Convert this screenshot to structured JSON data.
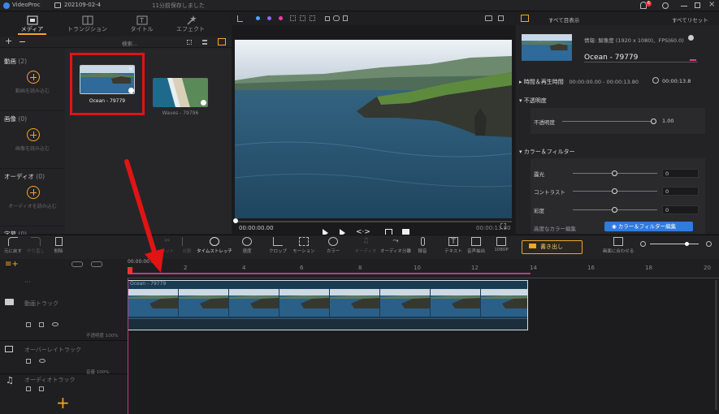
{
  "titlebar": {
    "app": "VideoProc",
    "project": "202109-02-4",
    "saved": "11分前保存しました",
    "notif_count": "6"
  },
  "tabs": [
    {
      "label": "メディア"
    },
    {
      "label": "トランジション"
    },
    {
      "label": "タイトル"
    },
    {
      "label": "エフェクト"
    }
  ],
  "media": {
    "search_placeholder": "検索...",
    "sections": [
      {
        "title": "動画",
        "count": "(2)",
        "hint": "動画を読み込む"
      },
      {
        "title": "画像",
        "count": "(0)",
        "hint": "画像を読み込む"
      },
      {
        "title": "オーディオ",
        "count": "(0)",
        "hint": "オーディオを読み込む"
      },
      {
        "title": "字幕",
        "count": "(0)"
      }
    ],
    "items": [
      {
        "name": "Ocean - 79779",
        "selected": true
      },
      {
        "name": "Waves - 79796",
        "selected": false
      }
    ]
  },
  "preview": {
    "time_current": "00:00:00.00",
    "time_total": "00:00:13.80"
  },
  "inspector": {
    "show_all": "すべて目表示",
    "reset_all": "すべてリセット",
    "info": "情報: 解像度 (1920 x 1080)、FPS(60.0)",
    "clip_name": "Ocean - 79779",
    "time_section": "時間＆再生時間",
    "time_range": "00:00:00.00 - 00:00:13.80",
    "duration": "00:00:13.8",
    "opacity_section": "不透明度",
    "opacity_label": "不透明度",
    "opacity_value": "1.00",
    "color_section": "カラー＆フィルター",
    "adjust": [
      {
        "label": "露光",
        "value": "0"
      },
      {
        "label": "コントラスト",
        "value": "0"
      },
      {
        "label": "彩度",
        "value": "0"
      }
    ],
    "advanced_label": "高度なカラー編集",
    "advanced_button": "カラー＆フィルター編集"
  },
  "toolbar": {
    "items": [
      {
        "label": "元に戻す"
      },
      {
        "label": "やり直し"
      },
      {
        "label": "削除"
      },
      {
        "label": "カット"
      },
      {
        "label": "分割"
      },
      {
        "label": "タイムストレッチ"
      },
      {
        "label": "速度"
      },
      {
        "label": "クロップ"
      },
      {
        "label": "モーション"
      },
      {
        "label": "カラー"
      },
      {
        "label": "オーディオ"
      },
      {
        "label": "オーディオ分離"
      },
      {
        "label": "録音"
      },
      {
        "label": "テキスト"
      },
      {
        "label": "音声抽出"
      },
      {
        "label": "1080P"
      }
    ],
    "export": "書き出し",
    "fit": "画面に合わせる"
  },
  "timeline": {
    "timecode": "00:00:00.00",
    "ruler": [
      "2",
      "4",
      "6",
      "8",
      "10",
      "12",
      "14",
      "16",
      "18",
      "20"
    ],
    "clip_label": "Ocean - 79779",
    "tracks": [
      {
        "name": "動画トラック"
      },
      {
        "name": "オーバーレイトラック",
        "opacity": "不透明度",
        "opacity_value": "100%"
      },
      {
        "name": "オーディオトラック",
        "volume": "音量",
        "volume_value": "100%"
      }
    ]
  }
}
